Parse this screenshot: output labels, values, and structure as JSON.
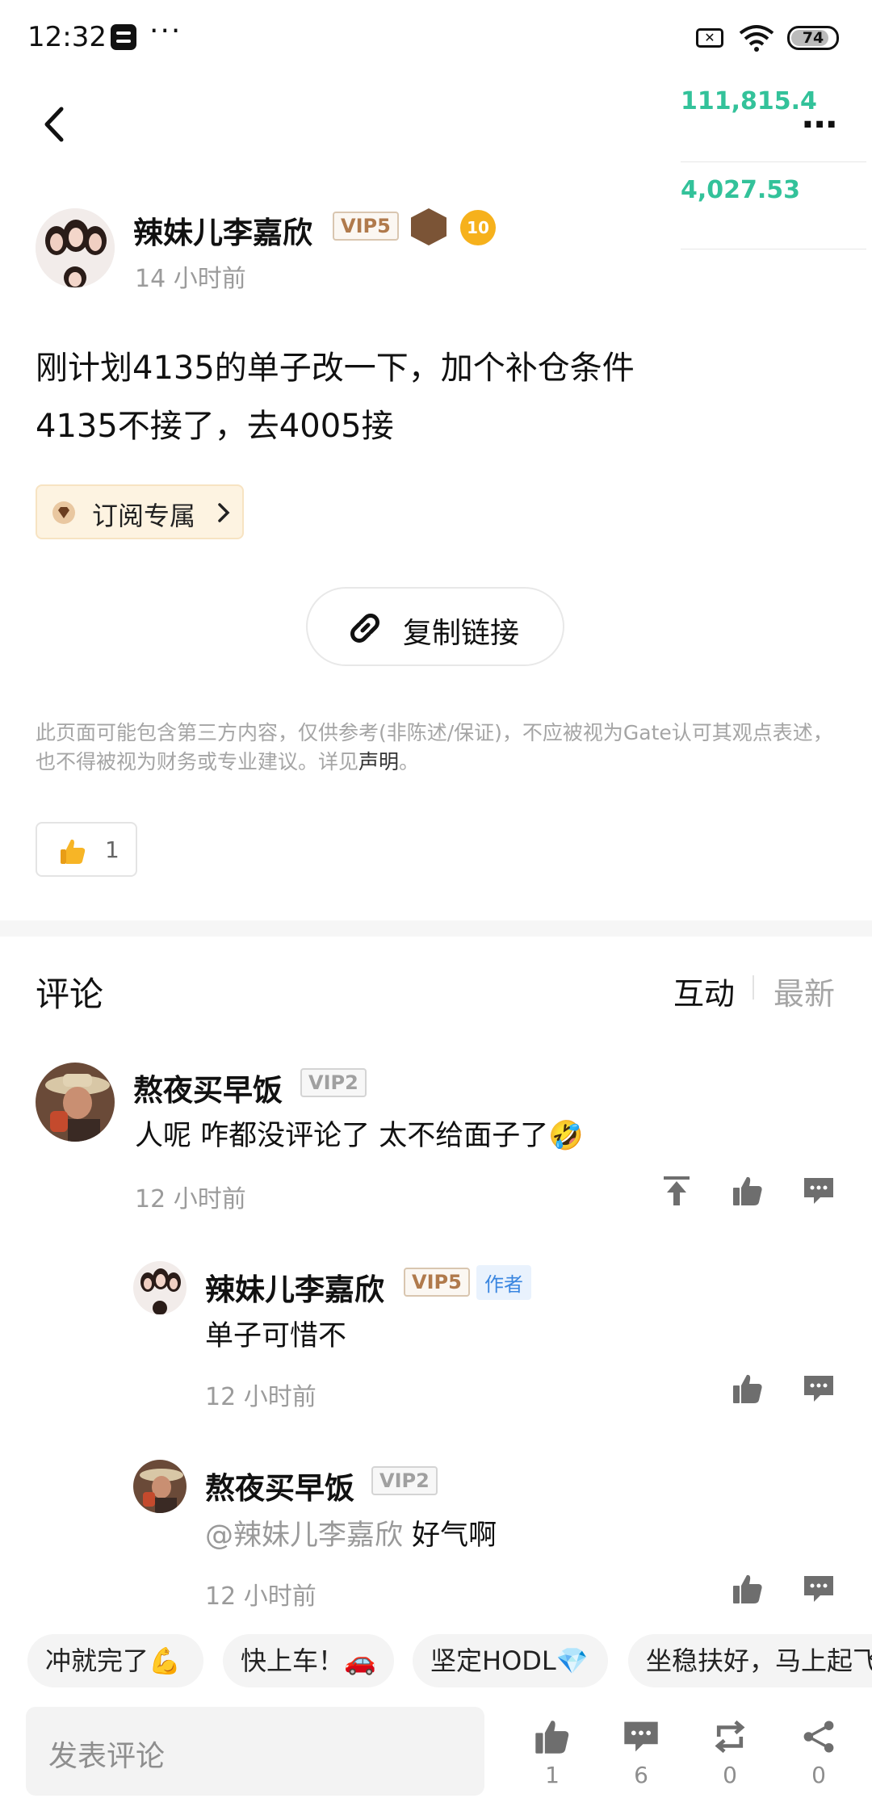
{
  "status_bar": {
    "time": "12:32",
    "dots": "···",
    "battery": "74"
  },
  "header": {
    "ticker_values": [
      "111,815.4",
      "4,027.53"
    ]
  },
  "post": {
    "author_name": "辣妹儿李嘉欣",
    "author_vip": "VIP5",
    "author_level": "10",
    "time": "14 小时前",
    "lines": [
      "刚计划4135的单子改一下，加个补仓条件",
      "4135不接了，去4005接"
    ],
    "subscribe_label": "订阅专属",
    "copy_link_label": "复制链接",
    "disclaimer": "此页面可能包含第三方内容，仅供参考(非陈述/保证)，不应被视为Gate认可其观点表述，也不得被视为财务或专业建议。详见",
    "disclaimer_link": "声明",
    "disclaimer_end": "。",
    "like_count": "1"
  },
  "comments_section": {
    "title": "评论",
    "sort_options": [
      "互动",
      "最新"
    ],
    "comments": [
      {
        "name": "熬夜买早饭",
        "vip": "VIP2",
        "text": "人呢 咋都没评论了 太不给面子了",
        "emoji": "🤣",
        "time": "12 小时前"
      }
    ],
    "replies": [
      {
        "name": "辣妹儿李嘉欣",
        "vip": "VIP5",
        "tag": "作者",
        "text": "单子可惜不",
        "time": "12 小时前"
      },
      {
        "name": "熬夜买早饭",
        "vip": "VIP2",
        "mention": "@辣妹儿李嘉欣",
        "text": " 好气啊",
        "time": "12 小时前"
      }
    ]
  },
  "quick_replies": [
    "冲就完了💪",
    "快上车！🚗",
    "坚定HODL💎",
    "坐稳扶好，马上起飞"
  ],
  "bottom_bar": {
    "input_placeholder": "发表评论",
    "like_count": "1",
    "comment_count": "6",
    "repost_count": "0",
    "share_count": "0"
  },
  "colors": {
    "accent_green": "#33c29a",
    "vip_gold": "#b07a4c",
    "author_tag_blue": "#3a86e0"
  }
}
